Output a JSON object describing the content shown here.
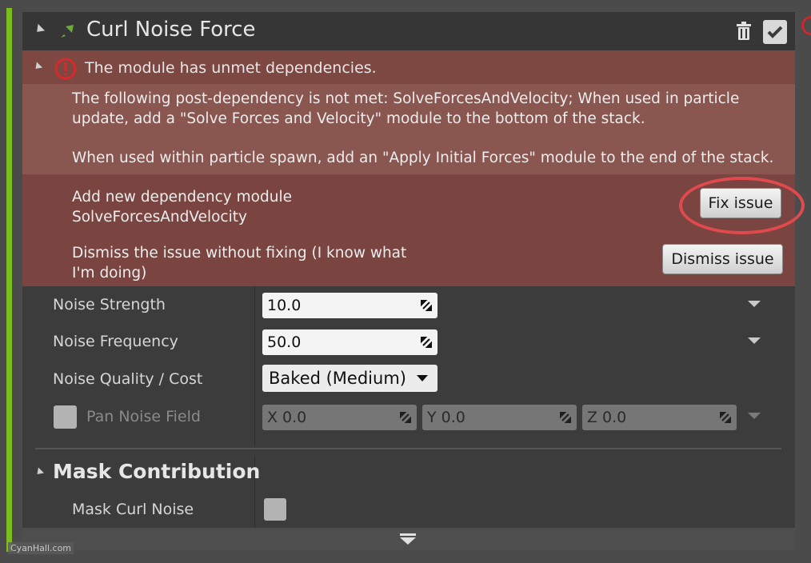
{
  "module": {
    "title": "Curl Noise Force",
    "icons": {
      "module": "arrow-force-icon",
      "delete": "trash-icon",
      "enable": "checkmark-icon",
      "edge_alert": "alert-icon"
    },
    "accent_color": "#7cbd1e"
  },
  "issue": {
    "title": "The module has unmet dependencies.",
    "description_lines": [
      "The following post-dependency is not met: SolveForcesAndVelocity; When used in particle",
      "update, add a \"Solve Forces and Velocity\" module to the bottom of the stack.",
      "When used within particle spawn, add an \"Apply Initial Forces\" module to the end of the stack."
    ],
    "fix": {
      "label_lines": [
        "Add new dependency module",
        "SolveForcesAndVelocity"
      ],
      "button": "Fix issue"
    },
    "dismiss": {
      "label_lines": [
        "Dismiss the issue without fixing (I know what",
        "I'm doing)"
      ],
      "button": "Dismiss issue"
    },
    "colors": {
      "band": "#7a4540",
      "highlight": "#e04a4e"
    }
  },
  "properties": {
    "noise_strength": {
      "label": "Noise Strength",
      "value": "10.0"
    },
    "noise_frequency": {
      "label": "Noise Frequency",
      "value": "50.0"
    },
    "noise_quality": {
      "label": "Noise Quality / Cost",
      "value": "Baked (Medium)"
    },
    "pan_noise_field": {
      "label": "Pan Noise Field",
      "x": "X  0.0",
      "y": "Y  0.0",
      "z": "Z  0.0"
    }
  },
  "mask_section": {
    "title": "Mask Contribution",
    "mask_curl_noise": {
      "label": "Mask Curl Noise"
    }
  },
  "watermark": "CyanHall.com"
}
